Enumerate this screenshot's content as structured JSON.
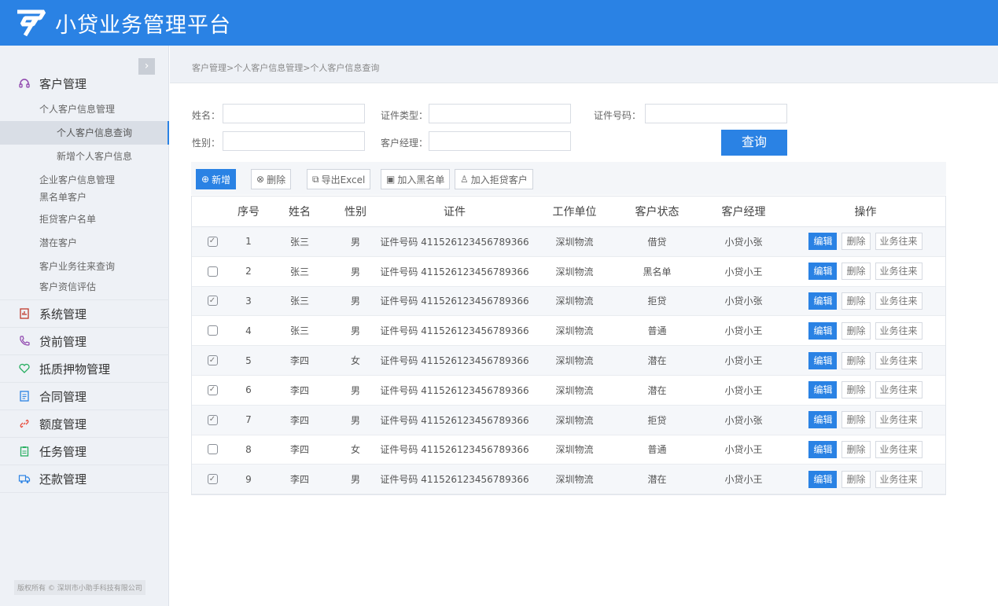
{
  "header": {
    "title": "小贷业务管理平台"
  },
  "sidebar": {
    "groups": [
      {
        "label": "客户管理",
        "icon": "headset-icon"
      },
      {
        "label": "系统管理",
        "icon": "clipboard-icon"
      },
      {
        "label": "贷前管理",
        "icon": "phone-icon"
      },
      {
        "label": "抵质押物管理",
        "icon": "heart-icon"
      },
      {
        "label": "合同管理",
        "icon": "document-icon"
      },
      {
        "label": "额度管理",
        "icon": "link-icon"
      },
      {
        "label": "任务管理",
        "icon": "task-icon"
      },
      {
        "label": "还款管理",
        "icon": "truck-icon"
      }
    ],
    "customer_sub": {
      "personal": "个人客户信息管理",
      "personal_query": "个人客户信息查询",
      "personal_add": "新增个人客户信息",
      "enterprise": "企业客户信息管理",
      "blacklist": "黑名单客户",
      "rejected": "拒贷客户名单",
      "potential": "潜在客户",
      "business_query": "客户业务往来查询",
      "credit_eval": "客户资信评估"
    },
    "copyright": "版权所有 © 深圳市小助手科技有限公司"
  },
  "breadcrumb": "客户管理>个人客户信息管理>个人客户信息查询",
  "form": {
    "name_label": "姓名：",
    "id_type_label": "证件类型：",
    "id_no_label": "证件号码：",
    "sex_label": "性别：",
    "manager_label": "客户经理：",
    "query_label": "查询"
  },
  "toolbar": {
    "add": "新增",
    "delete": "删除",
    "export": "导出Excel",
    "blacklist": "加入黑名单",
    "reject": "加入拒贷客户"
  },
  "table": {
    "headers": [
      "序号",
      "姓名",
      "性别",
      "证件",
      "工作单位",
      "客户状态",
      "客户经理",
      "操作"
    ],
    "ops": {
      "edit": "编辑",
      "delete": "删除",
      "business": "业务往来"
    },
    "rows": [
      {
        "checked": true,
        "no": "1",
        "name": "张三",
        "sex": "男",
        "id": "证件号码 411526123456789366",
        "unit": "深圳物流",
        "status": "借贷",
        "manager": "小贷小张"
      },
      {
        "checked": false,
        "no": "2",
        "name": "张三",
        "sex": "男",
        "id": "证件号码 411526123456789366",
        "unit": "深圳物流",
        "status": "黑名单",
        "manager": "小贷小王"
      },
      {
        "checked": true,
        "no": "3",
        "name": "张三",
        "sex": "男",
        "id": "证件号码 411526123456789366",
        "unit": "深圳物流",
        "status": "拒贷",
        "manager": "小贷小张"
      },
      {
        "checked": false,
        "no": "4",
        "name": "张三",
        "sex": "男",
        "id": "证件号码 411526123456789366",
        "unit": "深圳物流",
        "status": "普通",
        "manager": "小贷小王"
      },
      {
        "checked": true,
        "no": "5",
        "name": "李四",
        "sex": "女",
        "id": "证件号码 411526123456789366",
        "unit": "深圳物流",
        "status": "潜在",
        "manager": "小贷小王"
      },
      {
        "checked": true,
        "no": "6",
        "name": "李四",
        "sex": "男",
        "id": "证件号码 411526123456789366",
        "unit": "深圳物流",
        "status": "潜在",
        "manager": "小贷小王"
      },
      {
        "checked": true,
        "no": "7",
        "name": "李四",
        "sex": "男",
        "id": "证件号码 411526123456789366",
        "unit": "深圳物流",
        "status": "拒贷",
        "manager": "小贷小张"
      },
      {
        "checked": false,
        "no": "8",
        "name": "李四",
        "sex": "女",
        "id": "证件号码 411526123456789366",
        "unit": "深圳物流",
        "status": "普通",
        "manager": "小贷小王"
      },
      {
        "checked": true,
        "no": "9",
        "name": "李四",
        "sex": "男",
        "id": "证件号码 411526123456789366",
        "unit": "深圳物流",
        "status": "潜在",
        "manager": "小贷小王"
      }
    ]
  },
  "colors": {
    "primary": "#2a82e4",
    "sidebar_bg": "#eef1f6"
  }
}
